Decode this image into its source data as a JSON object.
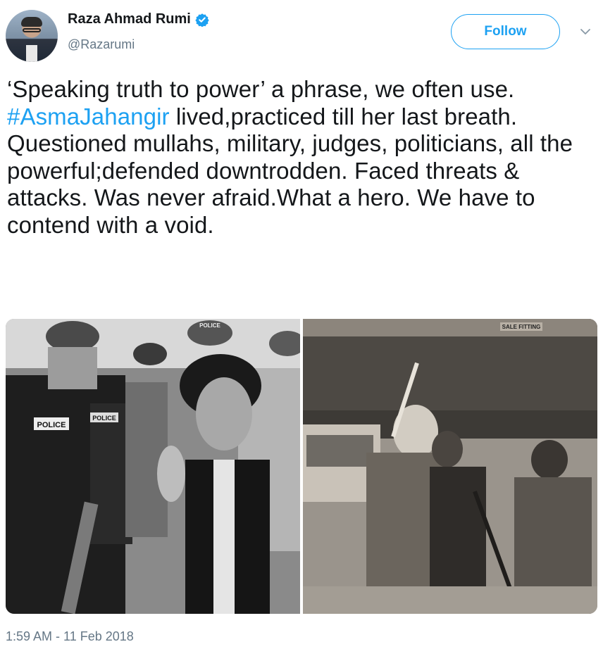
{
  "author": {
    "name": "Raza Ahmad Rumi",
    "handle": "@Razarumi",
    "verified": true
  },
  "follow_button": {
    "label": "Follow"
  },
  "tweet": {
    "text_parts": [
      "‘Speaking truth to power’ a phrase, we often use. ",
      "#AsmaJahangir",
      " lived,practiced till her last breath. Questioned mullahs, military, judges, politicians, all the powerful;defended downtrodden. Faced threats & attacks. Was never afraid.What a hero. We have to contend with a void."
    ]
  },
  "media": {
    "left_image": {
      "sign_texts": [
        "POLICE",
        "POLICE",
        "POLICE"
      ]
    },
    "right_image": {
      "sign_texts": [
        "SALE FITTING"
      ]
    }
  },
  "timestamp": "1:59 AM - 11 Feb 2018",
  "colors": {
    "accent": "#1da1f2",
    "text": "#14171a",
    "muted": "#657786"
  },
  "icons": {
    "verified": "verified-badge-icon",
    "caret": "chevron-down-icon"
  }
}
